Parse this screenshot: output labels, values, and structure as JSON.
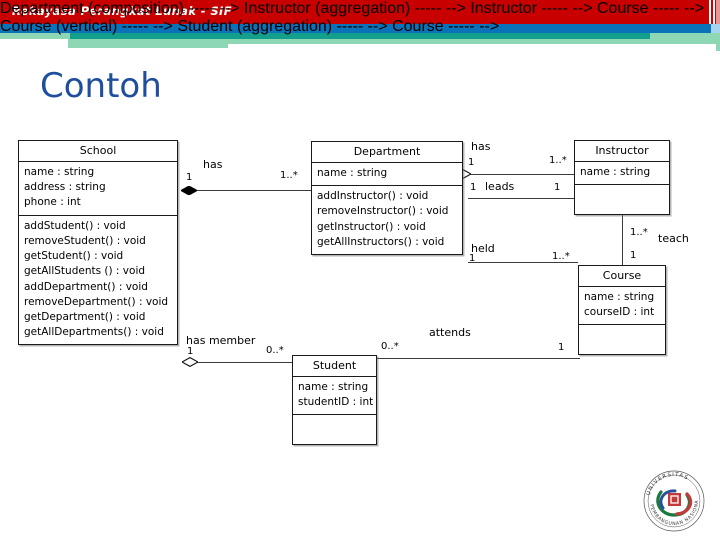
{
  "slide": {
    "banner_title": "Rekayasa Perangkat Lunak - SIF",
    "title": "Contoh",
    "colors": {
      "banner_red": "#c80000",
      "bar_blue": "#0a72b8",
      "bar_teal": "#12a08c",
      "bar_green": "#8ed7b4",
      "title_blue": "#1f4e9c"
    }
  },
  "diagram": {
    "type": "uml-class-diagram",
    "classes": [
      {
        "id": "school",
        "name": "School",
        "attributes": [
          "name : string",
          "address : string",
          "phone : int"
        ],
        "operations": [
          "addStudent() : void",
          "removeStudent() : void",
          "getStudent() : void",
          "getAllStudents () : void",
          "addDepartment() : void",
          "removeDepartment() : void",
          "getDepartment() : void",
          "getAllDepartments() : void"
        ]
      },
      {
        "id": "department",
        "name": "Department",
        "attributes": [
          "name : string"
        ],
        "operations": [
          "addInstructor() : void",
          "removeInstructor() : void",
          "getInstructor() : void",
          "getAllInstructors() : void"
        ]
      },
      {
        "id": "instructor",
        "name": "Instructor",
        "attributes": [
          "name : string"
        ],
        "operations": []
      },
      {
        "id": "course",
        "name": "Course",
        "attributes": [
          "name : string",
          "courseID : int"
        ],
        "operations": []
      },
      {
        "id": "student",
        "name": "Student",
        "attributes": [
          "name : string",
          "studentID : int"
        ],
        "operations": []
      }
    ],
    "associations": [
      {
        "id": "school-has-department",
        "label": "has",
        "from": "School",
        "to": "Department",
        "from_multiplicity": "1",
        "to_multiplicity": "1..*",
        "kind": "composition"
      },
      {
        "id": "department-has-instructor",
        "label": "has",
        "from": "Department",
        "to": "Instructor",
        "from_multiplicity": "1",
        "to_multiplicity": "1..*",
        "kind": "aggregation"
      },
      {
        "id": "department-leads-instructor",
        "label": "leads",
        "from": "Department",
        "to": "Instructor",
        "from_multiplicity": "1",
        "to_multiplicity": "1",
        "kind": "association"
      },
      {
        "id": "department-held-course",
        "label": "held",
        "from": "Department",
        "to": "Course",
        "from_multiplicity": "1",
        "to_multiplicity": "1..*",
        "kind": "association"
      },
      {
        "id": "instructor-teach-course",
        "label": "teach",
        "from": "Instructor",
        "to": "Course",
        "from_multiplicity": "1..*",
        "to_multiplicity": "1",
        "kind": "association"
      },
      {
        "id": "school-has-member-student",
        "label": "has member",
        "from": "School",
        "to": "Student",
        "from_multiplicity": "1",
        "to_multiplicity": "0..*",
        "kind": "aggregation"
      },
      {
        "id": "student-attends-course",
        "label": "attends",
        "from": "Student",
        "to": "Course",
        "from_multiplicity": "0..*",
        "to_multiplicity": "1",
        "kind": "association"
      }
    ]
  },
  "logo": {
    "name": "universitas-pembangunan-nasional-logo",
    "text_top": "UNIVERSITAS",
    "text_bottom": "PEMBANGUNAN NASIONAL"
  }
}
